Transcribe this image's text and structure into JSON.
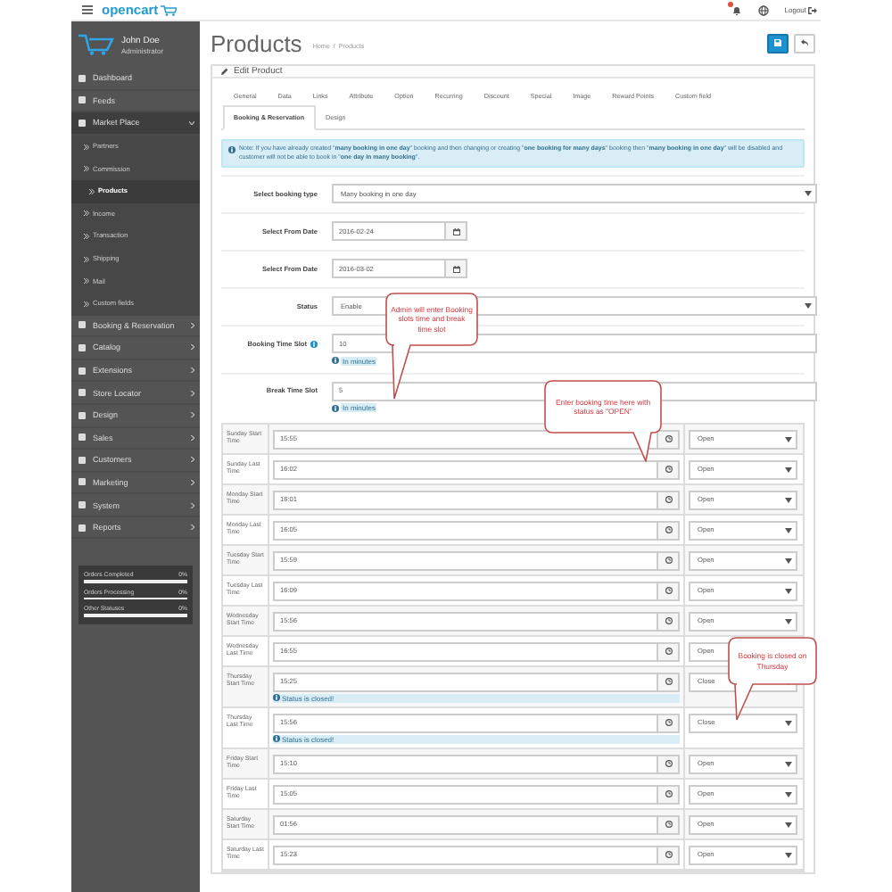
{
  "header": {
    "logo": "opencart",
    "logout": "Logout"
  },
  "user": {
    "name": "John Doe",
    "role": "Administrator"
  },
  "sidebar": {
    "items": [
      {
        "label": "Dashboard",
        "kind": "link",
        "expanded": false
      },
      {
        "label": "Feeds",
        "kind": "link",
        "expanded": false
      },
      {
        "label": "Market Place",
        "kind": "menu",
        "expanded": true,
        "children": [
          {
            "label": "Partners",
            "selected": false
          },
          {
            "label": "Commission",
            "selected": false
          },
          {
            "label": "Products",
            "selected": true
          },
          {
            "label": "Income",
            "selected": false
          },
          {
            "label": "Transaction",
            "selected": false
          },
          {
            "label": "Shipping",
            "selected": false
          },
          {
            "label": "Mail",
            "selected": false
          },
          {
            "label": "Custom fields",
            "selected": false
          }
        ]
      },
      {
        "label": "Booking & Reservation",
        "kind": "menu",
        "expanded": false
      },
      {
        "label": "Catalog",
        "kind": "menu",
        "expanded": false
      },
      {
        "label": "Extensions",
        "kind": "menu",
        "expanded": false
      },
      {
        "label": "Store Locator",
        "kind": "menu",
        "expanded": false
      },
      {
        "label": "Design",
        "kind": "menu",
        "expanded": false
      },
      {
        "label": "Sales",
        "kind": "menu",
        "expanded": false
      },
      {
        "label": "Customers",
        "kind": "menu",
        "expanded": false
      },
      {
        "label": "Marketing",
        "kind": "menu",
        "expanded": false
      },
      {
        "label": "System",
        "kind": "menu",
        "expanded": false
      },
      {
        "label": "Reports",
        "kind": "menu",
        "expanded": false
      }
    ],
    "stats": [
      {
        "label": "Orders Completed",
        "reading": "0%",
        "level": 0
      },
      {
        "label": "Orders Processing",
        "reading": "0%",
        "level": 0
      },
      {
        "label": "Other Statuses",
        "reading": "0%",
        "level": 0
      }
    ]
  },
  "page": {
    "title": "Products",
    "breadcrumb": [
      "Home",
      "Products"
    ],
    "breadcrumb_separator": "/"
  },
  "panel": {
    "title": "Edit Product",
    "tab_rows": [
      [
        {
          "label": "General",
          "selected": false
        },
        {
          "label": "Data",
          "selected": false
        },
        {
          "label": "Links",
          "selected": false
        },
        {
          "label": "Attribute",
          "selected": false
        },
        {
          "label": "Option",
          "selected": false
        },
        {
          "label": "Recurring",
          "selected": false
        },
        {
          "label": "Discount",
          "selected": false
        },
        {
          "label": "Special",
          "selected": false
        },
        {
          "label": "Image",
          "selected": false
        },
        {
          "label": "Reward Points",
          "selected": false
        },
        {
          "label": "Custom field",
          "selected": false
        }
      ],
      [
        {
          "label": "Booking & Reservation",
          "selected": true
        },
        {
          "label": "Design",
          "selected": false
        }
      ]
    ],
    "alert": "Note: If you have already created \"**many booking in one day**\" booking and then changing or creating \"**one booking for many days**\" booking then \"**many booking in one day**\" will be disabled and customer will not be able to book in \"**one day in many booking**\".",
    "fields": [
      {
        "kind": "select",
        "label": "Select booking type",
        "value": "Many booking in one day",
        "help": false
      },
      {
        "kind": "date",
        "label": "Select From Date",
        "value": "2016-02-24",
        "help": false
      },
      {
        "kind": "date",
        "label": "Select From Date",
        "value": "2016-03-02",
        "help": false
      },
      {
        "kind": "select",
        "label": "Status",
        "value": "Enable",
        "help": false
      },
      {
        "kind": "text",
        "label": "Booking Time Slot",
        "value": "10",
        "help": true,
        "hint": "In minutes"
      },
      {
        "kind": "text",
        "label": "Break Time Slot",
        "value": "5",
        "help": false,
        "hint": "In minutes"
      }
    ],
    "schedule": [
      {
        "label": "Sunday Start Time",
        "time": "15:55",
        "status": "Open"
      },
      {
        "label": "Sunday Last Time",
        "time": "16:02",
        "status": "Open"
      },
      {
        "label": "Monday Start Time",
        "time": "16:01",
        "status": "Open"
      },
      {
        "label": "Monday Last Time",
        "time": "16:05",
        "status": "Open"
      },
      {
        "label": "Tuesday Start Time",
        "time": "15:59",
        "status": "Open"
      },
      {
        "label": "Tuesday Last Time",
        "time": "16:09",
        "status": "Open"
      },
      {
        "label": "Wednesday Start Time",
        "time": "15:56",
        "status": "Open"
      },
      {
        "label": "Wednesday Last Time",
        "time": "16:55",
        "status": "Open"
      },
      {
        "label": "Thursday Start Time",
        "time": "15:25",
        "status": "Close",
        "note": "Status is closed!"
      },
      {
        "label": "Thursday Last Time",
        "time": "15:56",
        "status": "Close",
        "note": "Status is closed!"
      },
      {
        "label": "Friday Start Time",
        "time": "15:10",
        "status": "Open"
      },
      {
        "label": "Friday Last Time",
        "time": "15:05",
        "status": "Open"
      },
      {
        "label": "Saturday Start Time",
        "time": "01:56",
        "status": "Open"
      },
      {
        "label": "Saturday Last Time",
        "time": "15:23",
        "status": "Open"
      }
    ]
  },
  "annotations": [
    {
      "text": "Admin will enter Booking slots time and break time slot"
    },
    {
      "text": "Enter booking time here with status as \"OPEN\""
    },
    {
      "text": "Booking is closed on Thursday"
    }
  ]
}
